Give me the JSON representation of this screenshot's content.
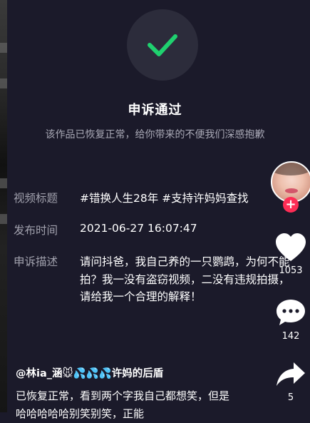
{
  "dialog": {
    "title": "申诉通过",
    "subtitle": "该作品已恢复正常，给你带来的不便我们深感抱歉"
  },
  "details": {
    "video_title_label": "视频标题",
    "video_title_value": "#错换人生28年 #支持许妈妈查找",
    "publish_time_label": "发布时间",
    "publish_time_value": "2021-06-27 16:07:47",
    "appeal_desc_label": "申诉描述",
    "appeal_desc_value": "请问抖爸，我自己养的一只鹦鹉，为何不能拍？我一没有盗窃视频，二没有违规拍摄，请给我一个合理的解释！"
  },
  "comment": {
    "user": "@林ia_涵🐭💦💦💦许妈的后盾",
    "text": "已恢复正常，看到两个字我自己都想笑，但是哈哈哈哈哈别笑别笑，正能"
  },
  "actions": {
    "like_count": "1053",
    "comment_count": "142",
    "share_count": "5"
  },
  "colors": {
    "background": "#1b1a2a",
    "check_green": "#1fd16f",
    "follow_badge": "#fe2c55"
  },
  "icons": [
    "check-icon",
    "plus-icon",
    "heart-icon",
    "comment-icon",
    "share-icon"
  ]
}
